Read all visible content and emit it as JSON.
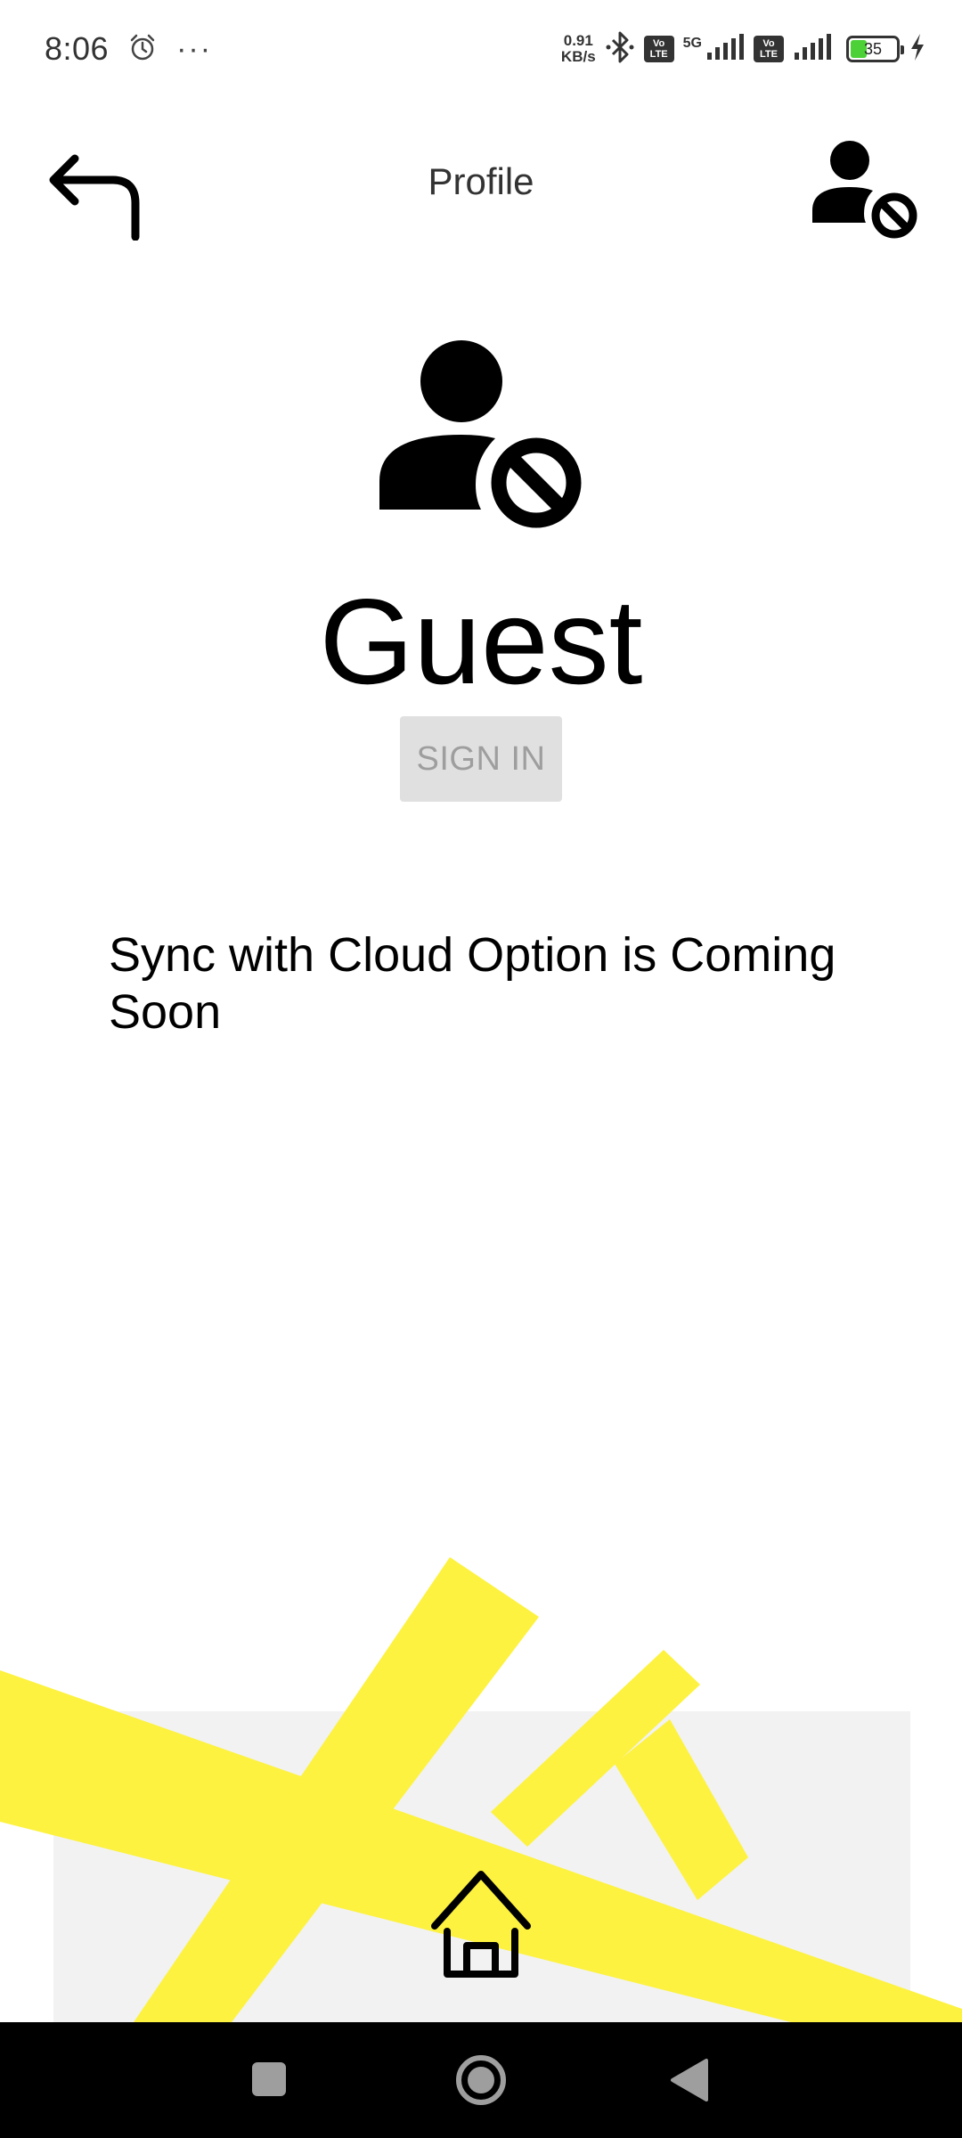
{
  "status_bar": {
    "time": "8:06",
    "more_dots": "···",
    "net_speed_value": "0.91",
    "net_speed_unit": "KB/s",
    "network_type": "5G",
    "volte_label_top": "Vo",
    "volte_label_bottom": "LTE",
    "battery_level": "35",
    "battery_fraction": 0.35,
    "icons": [
      "alarm-icon",
      "bluetooth-icon",
      "volte-icon",
      "signal-icon",
      "signal-icon",
      "battery-icon",
      "charging-icon"
    ]
  },
  "header": {
    "title": "Profile",
    "back_icon": "back-arrow-icon",
    "user_icon": "user-blocked-icon"
  },
  "profile": {
    "avatar_icon": "user-blocked-icon",
    "name": "Guest",
    "sign_in_label": "SIGN IN"
  },
  "sync_message": "Sync with Cloud Option is Coming Soon",
  "bottom": {
    "home_icon": "home-icon",
    "accent_color": "#fdf23f",
    "panel_color": "#f2f2f2"
  },
  "nav_bar": {
    "icons": [
      "recents-square-icon",
      "home-circle-icon",
      "back-triangle-icon"
    ]
  }
}
